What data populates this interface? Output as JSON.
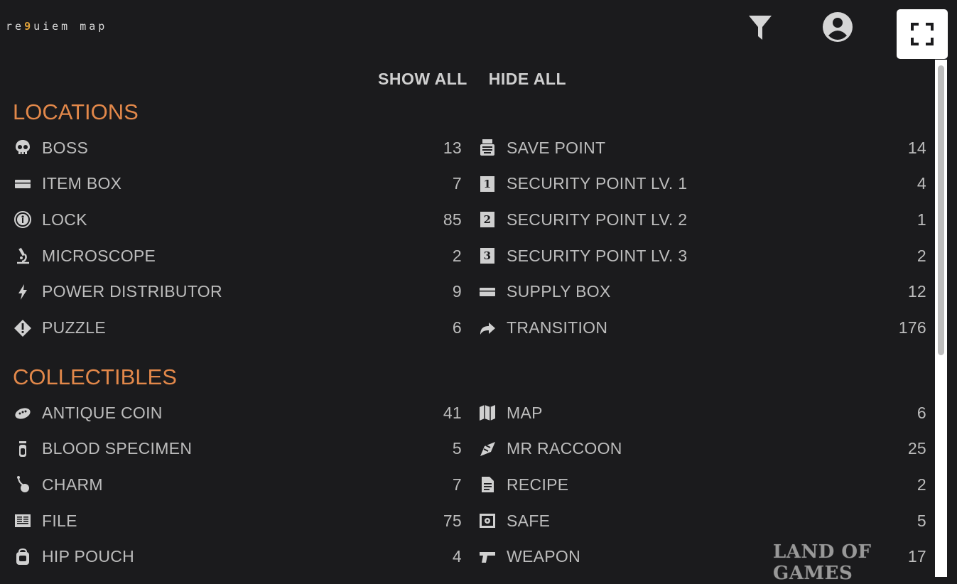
{
  "logo": {
    "part1": "re",
    "nine": "9",
    "part2": "uiem map"
  },
  "header": {
    "filter_icon": "filter-icon",
    "account_icon": "account-circle-icon",
    "fullscreen_icon": "fullscreen-icon"
  },
  "toggles": {
    "show_all": "SHOW ALL",
    "hide_all": "HIDE ALL"
  },
  "sections": {
    "locations": {
      "title": "LOCATIONS",
      "left": [
        {
          "icon": "skull-icon",
          "label": "BOSS",
          "count": "13"
        },
        {
          "icon": "item-box-icon",
          "label": "ITEM BOX",
          "count": "7"
        },
        {
          "icon": "lock-icon",
          "label": "LOCK",
          "count": "85"
        },
        {
          "icon": "microscope-icon",
          "label": "MICROSCOPE",
          "count": "2"
        },
        {
          "icon": "lightning-icon",
          "label": "POWER DISTRIBUTOR",
          "count": "9"
        },
        {
          "icon": "puzzle-diamond-icon",
          "label": "PUZZLE",
          "count": "6"
        }
      ],
      "right": [
        {
          "icon": "typewriter-icon",
          "label": "SAVE POINT",
          "count": "14"
        },
        {
          "icon": "security-level-1-icon",
          "label": "SECURITY POINT LV. 1",
          "count": "4",
          "num": "1"
        },
        {
          "icon": "security-level-2-icon",
          "label": "SECURITY POINT LV. 2",
          "count": "1",
          "num": "2"
        },
        {
          "icon": "security-level-3-icon",
          "label": "SECURITY POINT LV. 3",
          "count": "2",
          "num": "3"
        },
        {
          "icon": "supply-box-icon",
          "label": "SUPPLY BOX",
          "count": "12"
        },
        {
          "icon": "arrow-forward-icon",
          "label": "TRANSITION",
          "count": "176"
        }
      ]
    },
    "collectibles": {
      "title": "COLLECTIBLES",
      "left": [
        {
          "icon": "antique-coin-icon",
          "label": "ANTIQUE COIN",
          "count": "41"
        },
        {
          "icon": "specimen-vial-icon",
          "label": "BLOOD SPECIMEN",
          "count": "5"
        },
        {
          "icon": "charm-icon",
          "label": "CHARM",
          "count": "7"
        },
        {
          "icon": "file-icon",
          "label": "FILE",
          "count": "75"
        },
        {
          "icon": "hip-pouch-icon",
          "label": "HIP POUCH",
          "count": "4"
        }
      ],
      "right": [
        {
          "icon": "map-icon",
          "label": "MAP",
          "count": "6"
        },
        {
          "icon": "raccoon-icon",
          "label": "MR RACCOON",
          "count": "25"
        },
        {
          "icon": "recipe-document-icon",
          "label": "RECIPE",
          "count": "2"
        },
        {
          "icon": "safe-icon",
          "label": "SAFE",
          "count": "5"
        },
        {
          "icon": "pistol-icon",
          "label": "WEAPON",
          "count": "17"
        }
      ]
    }
  },
  "watermark": "LAND OF GAMES",
  "colors": {
    "background": "#1b1b1d",
    "section_title": "#e2884a",
    "text": "#bdbdbd"
  }
}
